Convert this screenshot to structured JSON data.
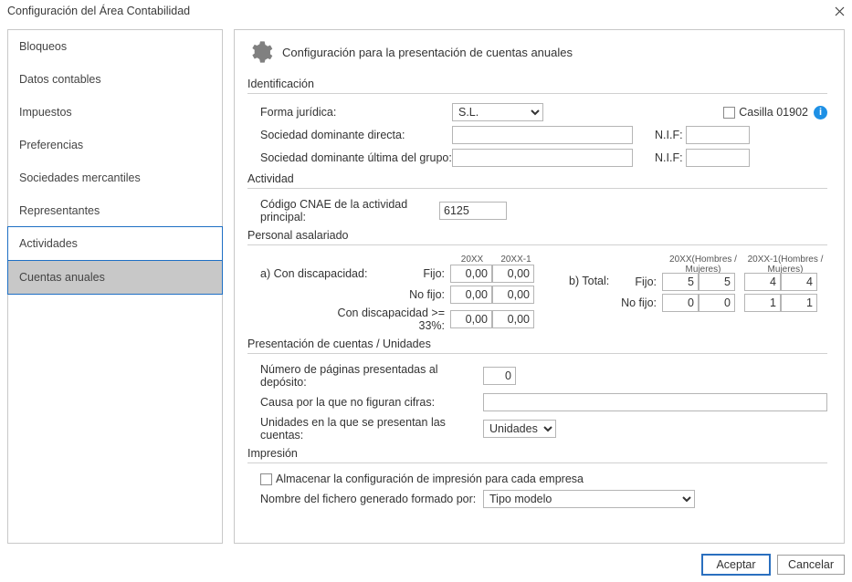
{
  "window": {
    "title": "Configuración del Área Contabilidad"
  },
  "sidebar": {
    "items": [
      {
        "label": "Bloqueos"
      },
      {
        "label": "Datos contables"
      },
      {
        "label": "Impuestos"
      },
      {
        "label": "Preferencias"
      },
      {
        "label": "Sociedades mercantiles"
      },
      {
        "label": "Representantes"
      },
      {
        "label": "Actividades"
      },
      {
        "label": "Cuentas anuales"
      }
    ]
  },
  "page": {
    "heading": "Configuración para la presentación de cuentas anuales",
    "identificacion": {
      "title": "Identificación",
      "forma_label": "Forma jurídica:",
      "forma_value": "S.L.",
      "casilla_label": "Casilla 01902",
      "sociedad_directa_label": "Sociedad dominante directa:",
      "sociedad_directa_value": "",
      "sociedad_grupo_label": "Sociedad dominante última del grupo:",
      "sociedad_grupo_value": "",
      "nif_label": "N.I.F:",
      "nif_directa": "",
      "nif_grupo": ""
    },
    "actividad": {
      "title": "Actividad",
      "cnae_label": "Código CNAE de la actividad principal:",
      "cnae_value": "6125"
    },
    "personal": {
      "title": "Personal asalariado",
      "a_label": "a) Con discapacidad:",
      "fijo_label": "Fijo:",
      "nofijo_label": "No fijo:",
      "gte33_label": "Con discapacidad >= 33%:",
      "col_20xx": "20XX",
      "col_20xx1": "20XX-1",
      "a_fijo_20xx": "0,00",
      "a_fijo_20xx1": "0,00",
      "a_nofijo_20xx": "0,00",
      "a_nofijo_20xx1": "0,00",
      "a_gte33_20xx": "0,00",
      "a_gte33_20xx1": "0,00",
      "b_label": "b) Total:",
      "b_col1": "20XX(Hombres / Mujeres)",
      "b_col2": "20XX-1(Hombres / Mujeres)",
      "b_fijo_h": "5",
      "b_fijo_m": "5",
      "b_fijo1_h": "4",
      "b_fijo1_m": "4",
      "b_nofijo_h": "0",
      "b_nofijo_m": "0",
      "b_nofijo1_h": "1",
      "b_nofijo1_m": "1"
    },
    "presentacion": {
      "title": "Presentación de cuentas / Unidades",
      "paginas_label": "Número de páginas presentadas al depósito:",
      "paginas_value": "0",
      "causa_label": "Causa por la que no figuran cifras:",
      "causa_value": "",
      "unidades_label": "Unidades en la que se presentan las cuentas:",
      "unidades_value": "Unidades"
    },
    "impresion": {
      "title": "Impresión",
      "almacenar_label": "Almacenar la configuración de impresión para cada empresa",
      "fichero_label": "Nombre del fichero generado formado por:",
      "fichero_value": "Tipo modelo"
    }
  },
  "buttons": {
    "accept": "Aceptar",
    "cancel": "Cancelar"
  }
}
